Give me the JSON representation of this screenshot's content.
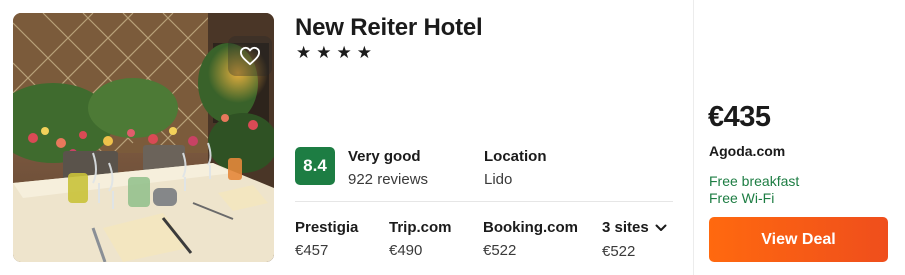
{
  "hotel": {
    "name": "New Reiter Hotel",
    "stars": "★★★★"
  },
  "rating": {
    "score": "8.4",
    "label": "Very good",
    "reviews": "922 reviews"
  },
  "location": {
    "label": "Location",
    "value": "Lido"
  },
  "sites": [
    {
      "name": "Prestigia",
      "price": "€457"
    },
    {
      "name": "Trip.com",
      "price": "€490"
    },
    {
      "name": "Booking.com",
      "price": "€522"
    }
  ],
  "more_sites": {
    "label": "3 sites",
    "price": "€522"
  },
  "deal": {
    "price": "€435",
    "provider": "Agoda.com",
    "perks": [
      "Free breakfast",
      "Free Wi-Fi"
    ],
    "button_label": "View Deal"
  },
  "colors": {
    "rating_badge": "#1d7d43",
    "perk_text": "#1d7d43",
    "button_start": "#ff690f",
    "button_end": "#ef4e1c"
  },
  "icons": {
    "favorite": "heart-outline-icon",
    "expand": "chevron-down-icon"
  }
}
